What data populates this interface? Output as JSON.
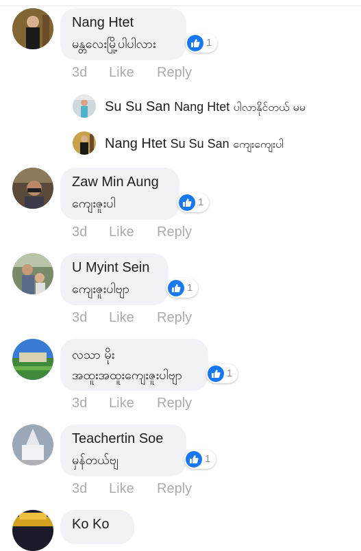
{
  "comments": [
    {
      "name": "Nang Htet",
      "text": "မန္တလေးမြို့ပါပါလား",
      "likes": "1",
      "time": "3d",
      "like_label": "Like",
      "reply_label": "Reply"
    },
    {
      "name": "Zaw Min Aung",
      "text": "ကျေးဇူးပါ",
      "likes": "1",
      "time": "3d",
      "like_label": "Like",
      "reply_label": "Reply"
    },
    {
      "name": "U Myint Sein",
      "text": "ကျေးဇူးပါဗျာ",
      "likes": "1",
      "time": "3d",
      "like_label": "Like",
      "reply_label": "Reply"
    },
    {
      "name": "လသာ မိုး",
      "text": "အထူးအထူးကျေးဇူးပါဗျာ",
      "likes": "1",
      "time": "3d",
      "like_label": "Like",
      "reply_label": "Reply"
    },
    {
      "name": "Teachertin Soe",
      "text": "မှန်တယ်ဗျ",
      "likes": "1",
      "time": "3d",
      "like_label": "Like",
      "reply_label": "Reply"
    },
    {
      "name": "Ko Ko"
    }
  ],
  "replies": [
    {
      "name": "Su Su San",
      "tag": "Nang Htet",
      "text": "ပါလာနိုင်တယ် မမ"
    },
    {
      "name": "Nang Htet",
      "tag": "Su Su San",
      "text": "ကျေးကျေးပါ"
    }
  ],
  "colors": {
    "accent": "#1877f2",
    "bubble": "#f0f2f5",
    "meta": "#a8abb0"
  }
}
